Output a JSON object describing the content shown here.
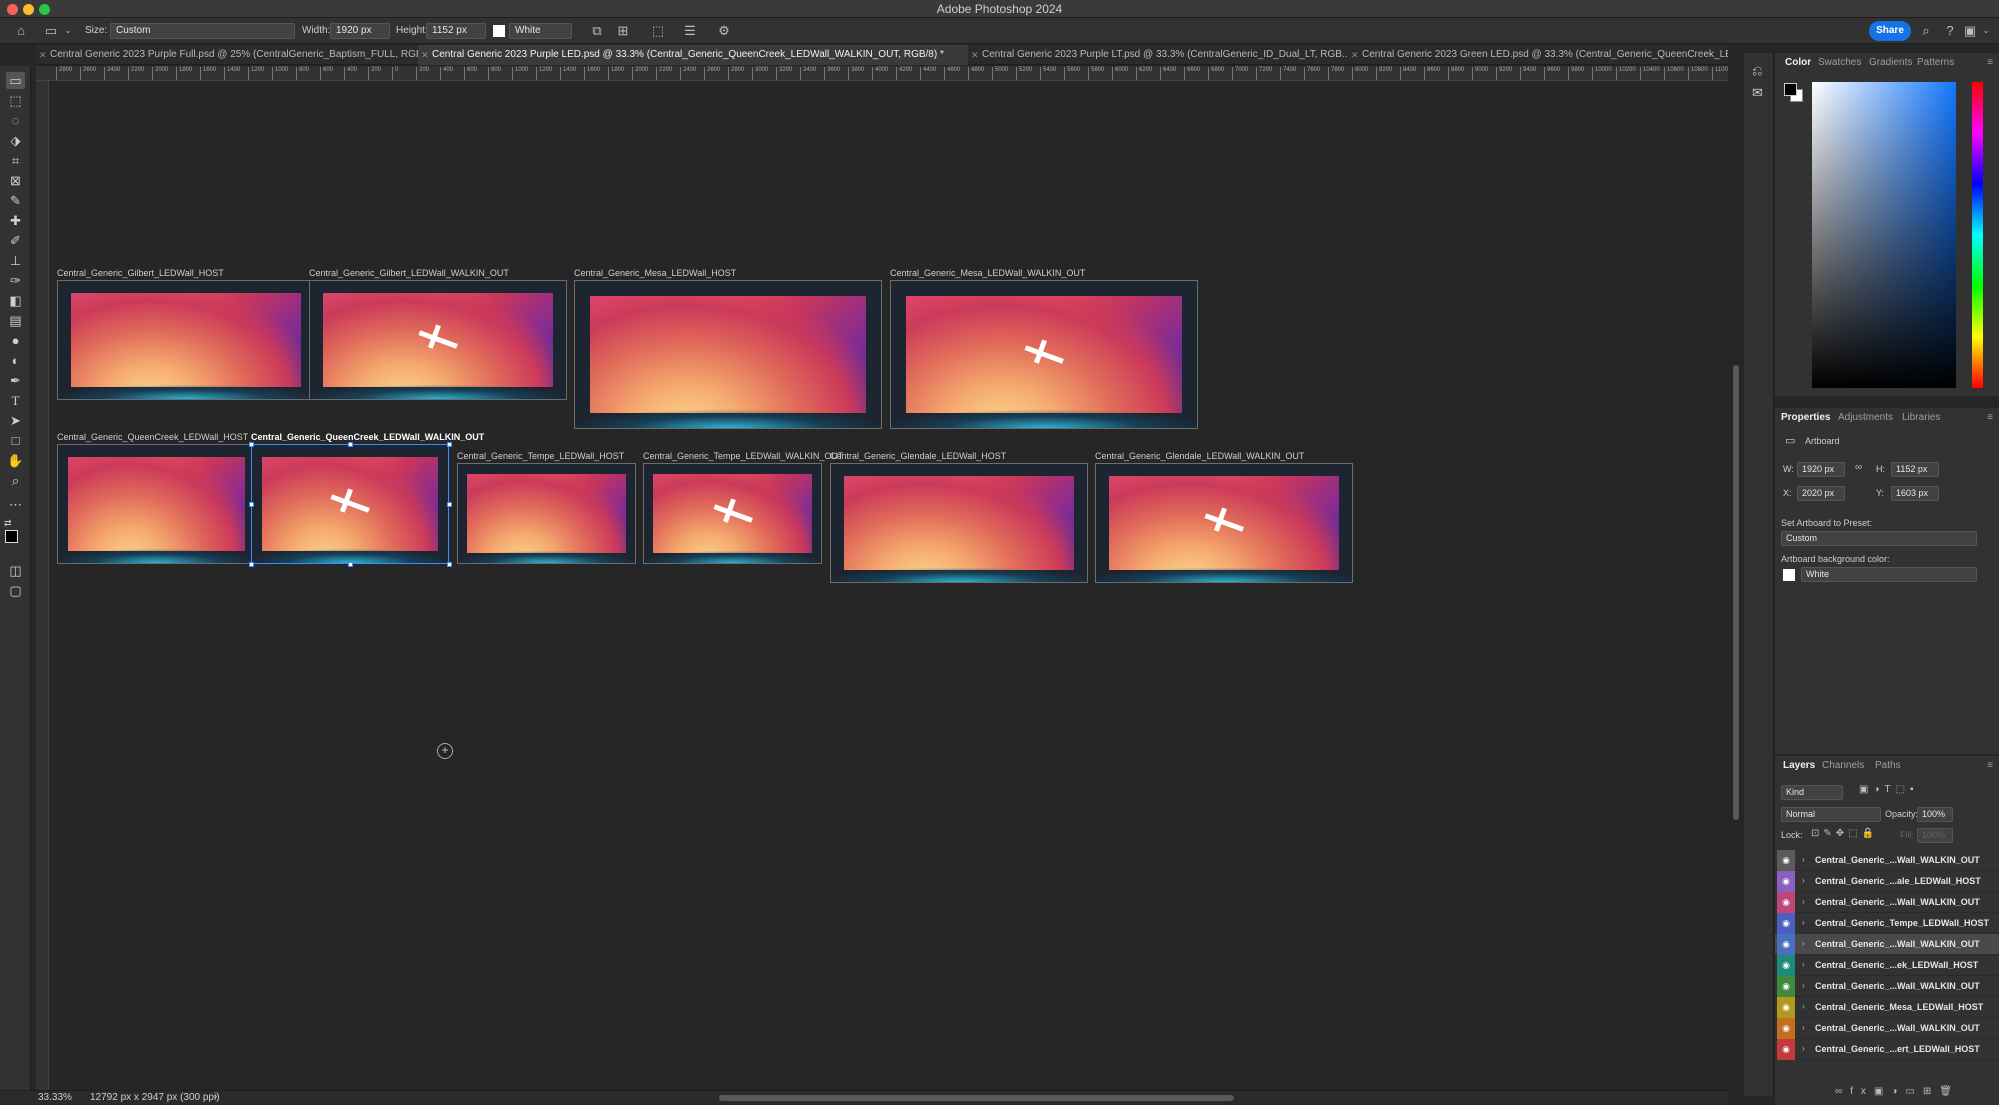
{
  "app": {
    "title": "Adobe Photoshop 2024"
  },
  "colors": {
    "accent": "#1473e6",
    "selection": "#3b8cff",
    "traffic_close": "#ff5f57",
    "traffic_min": "#febc2e",
    "traffic_max": "#28c840"
  },
  "options_bar": {
    "size_label": "Size:",
    "size_value": "Custom",
    "width_label": "Width:",
    "width_value": "1920 px",
    "height_label": "Height:",
    "height_value": "1152 px",
    "bg_value": "White",
    "share_label": "Share"
  },
  "tabs": [
    {
      "label": "Central Generic 2023 Purple Full.psd @ 25% (CentralGeneric_Baptism_FULL, RGB..."
    },
    {
      "label": "Central Generic 2023 Purple LED.psd @ 33.3% (Central_Generic_QueenCreek_LEDWall_WALKIN_OUT, RGB/8) *"
    },
    {
      "label": "Central Generic 2023 Purple LT.psd @ 33.3% (CentralGeneric_ID_Dual_LT, RGB..."
    },
    {
      "label": "Central Generic 2023 Green LED.psd @ 33.3% (Central_Generic_QueenCreek_LEDWall_WALKIN_OUT, RGB/8)..."
    }
  ],
  "ruler_ticks": [
    "2800",
    "2600",
    "2400",
    "2200",
    "2000",
    "1800",
    "1600",
    "1400",
    "1200",
    "1000",
    "800",
    "600",
    "400",
    "200",
    "0",
    "200",
    "400",
    "600",
    "800",
    "1000",
    "1200",
    "1400",
    "1600",
    "1800",
    "2000",
    "2200",
    "2400",
    "2600",
    "2800",
    "3000",
    "3200",
    "3400",
    "3600",
    "3800",
    "4000",
    "4200",
    "4400",
    "4600",
    "4800",
    "5000",
    "5200",
    "5400",
    "5600",
    "5800",
    "6000",
    "6200",
    "6400",
    "6600",
    "6800",
    "7000",
    "7200",
    "7400",
    "7600",
    "7800",
    "8000",
    "8200",
    "8400",
    "8600",
    "8800",
    "9000",
    "9200",
    "9400",
    "9600",
    "9800",
    "10000",
    "10200",
    "10400",
    "10600",
    "10800",
    "11000",
    "11200",
    "11400"
  ],
  "artboards": [
    {
      "name": "Central_Generic_Gilbert_LEDWall_HOST",
      "cross": false,
      "selected": false
    },
    {
      "name": "Central_Generic_Gilbert_LEDWall_WALKIN_OUT",
      "cross": true,
      "selected": false
    },
    {
      "name": "Central_Generic_Mesa_LEDWall_HOST",
      "cross": false,
      "selected": false
    },
    {
      "name": "Central_Generic_Mesa_LEDWall_WALKIN_OUT",
      "cross": true,
      "selected": false
    },
    {
      "name": "Central_Generic_QueenCreek_LEDWall_HOST",
      "cross": false,
      "selected": false
    },
    {
      "name": "Central_Generic_QueenCreek_LEDWall_WALKIN_OUT",
      "cross": true,
      "selected": true
    },
    {
      "name": "Central_Generic_Tempe_LEDWall_HOST",
      "cross": false,
      "selected": false
    },
    {
      "name": "Central_Generic_Tempe_LEDWall_WALKIN_OUT",
      "cross": true,
      "selected": false
    },
    {
      "name": "Central_Generic_Glendale_LEDWall_HOST",
      "cross": false,
      "selected": false
    },
    {
      "name": "Central_Generic_Glendale_LEDWall_WALKIN_OUT",
      "cross": true,
      "selected": false
    }
  ],
  "status": {
    "zoom": "33.33%",
    "doc_info": "12792 px x 2947 px (300 ppi)"
  },
  "color_panel": {
    "tabs": [
      "Color",
      "Swatches",
      "Gradients",
      "Patterns"
    ]
  },
  "properties_panel": {
    "tabs": [
      "Properties",
      "Adjustments",
      "Libraries"
    ],
    "type_label": "Artboard",
    "w_label": "W:",
    "w_value": "1920 px",
    "h_label": "H:",
    "h_value": "1152 px",
    "x_label": "X:",
    "x_value": "2020 px",
    "y_label": "Y:",
    "y_value": "1603 px",
    "preset_label": "Set Artboard to Preset:",
    "preset_value": "Custom",
    "bg_label": "Artboard background color:",
    "bg_value": "White"
  },
  "layers_panel": {
    "tabs": [
      "Layers",
      "Channels",
      "Paths"
    ],
    "filter_value": "Kind",
    "blend_mode": "Normal",
    "opacity_label": "Opacity:",
    "opacity_value": "100%",
    "lock_label": "Lock:",
    "fill_label": "Fill:",
    "fill_value": "100%",
    "layers": [
      {
        "name": "Central_Generic_...Wall_WALKIN_OUT",
        "color": "#5b5b5b",
        "selected": false
      },
      {
        "name": "Central_Generic_...ale_LEDWall_HOST",
        "color": "#8a5fbf",
        "selected": false
      },
      {
        "name": "Central_Generic_...Wall_WALKIN_OUT",
        "color": "#c2457a",
        "selected": false
      },
      {
        "name": "Central_Generic_Tempe_LEDWall_HOST",
        "color": "#4a5fbf",
        "selected": false
      },
      {
        "name": "Central_Generic_...Wall_WALKIN_OUT",
        "color": "#4a6fc0",
        "selected": true
      },
      {
        "name": "Central_Generic_...ek_LEDWall_HOST",
        "color": "#1f8a7a",
        "selected": false
      },
      {
        "name": "Central_Generic_...Wall_WALKIN_OUT",
        "color": "#3f8a3f",
        "selected": false
      },
      {
        "name": "Central_Generic_Mesa_LEDWall_HOST",
        "color": "#b39a1f",
        "selected": false
      },
      {
        "name": "Central_Generic_...Wall_WALKIN_OUT",
        "color": "#c2701f",
        "selected": false
      },
      {
        "name": "Central_Generic_...ert_LEDWall_HOST",
        "color": "#c23a3a",
        "selected": false
      }
    ]
  }
}
